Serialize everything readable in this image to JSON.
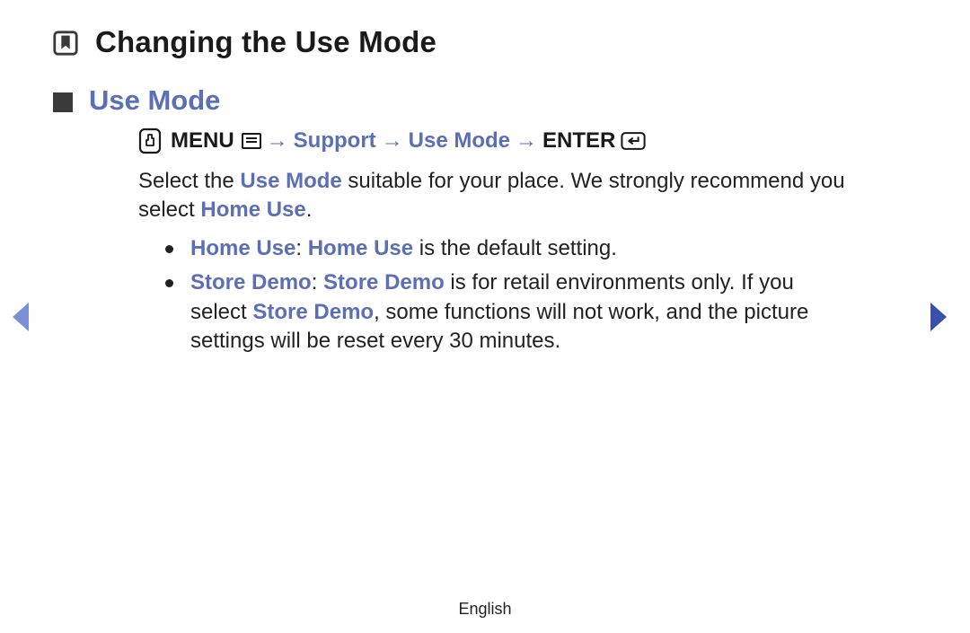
{
  "title": "Changing the Use Mode",
  "section_title": "Use Mode",
  "nav_path": {
    "menu": "MENU",
    "arrow": "→",
    "support": "Support",
    "use_mode": "Use Mode",
    "enter": "ENTER"
  },
  "body": {
    "pre1": "Select the ",
    "hl1": "Use Mode",
    "mid1": " suitable for your place. We strongly recommend you select ",
    "hl2": "Home Use",
    "post1": "."
  },
  "bullets": {
    "b1": {
      "hl1": "Home Use",
      "sep": ": ",
      "hl2": "Home Use",
      "rest": " is the default setting."
    },
    "b2": {
      "hl1": "Store Demo",
      "sep": ": ",
      "hl2": "Store Demo",
      "mid": " is for retail environments only. If you select ",
      "hl3": "Store Demo",
      "rest": ", some functions will not work, and the picture settings will be reset every 30 minutes."
    }
  },
  "footer": "English"
}
